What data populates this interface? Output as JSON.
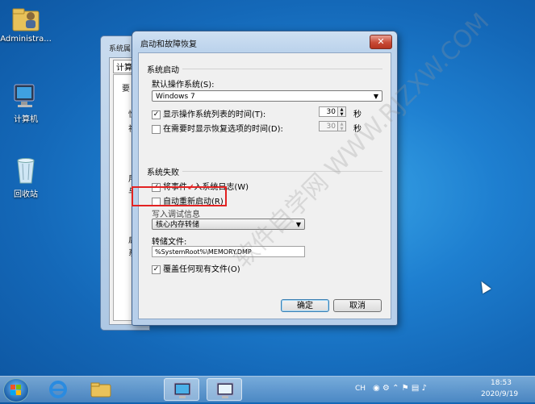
{
  "desktop": {
    "icons": [
      {
        "label": "Administra..."
      },
      {
        "label": "计算机"
      },
      {
        "label": "回收站"
      }
    ]
  },
  "back_window": {
    "title": "系统属",
    "tab": "计算",
    "fragments": [
      "要",
      "性",
      "视",
      "用",
      "与",
      "启",
      "系"
    ]
  },
  "dialog": {
    "title": "启动和故障恢复",
    "close_symbol": "✕",
    "startup": {
      "group_title": "系统启动",
      "default_os_label": "默认操作系统(S):",
      "default_os_value": "Windows 7",
      "show_list_label": "显示操作系统列表的时间(T):",
      "show_list_checked": true,
      "show_list_value": "30",
      "show_list_unit": "秒",
      "show_recovery_label": "在需要时显示恢复选项的时间(D):",
      "show_recovery_checked": false,
      "show_recovery_value": "30",
      "show_recovery_unit": "秒"
    },
    "failure": {
      "group_title": "系统失败",
      "write_event_label": "将事件",
      "write_event_label2": "入系统日志(W)",
      "write_event_checked": true,
      "auto_restart_label": "自动重新启动(R)",
      "auto_restart_checked": false,
      "debug_info_label": "写入调试信息",
      "debug_type_value": "核心内存转储",
      "dump_file_label": "转储文件:",
      "dump_file_value": "%SystemRoot%\\MEMORY.DMP",
      "overwrite_label": "覆盖任何现有文件(O)",
      "overwrite_checked": true
    },
    "ok_label": "确定",
    "cancel_label": "取消"
  },
  "watermark": "软件自学网 WWW.RJZXW.COM",
  "taskbar": {
    "lang": "CH",
    "time": "18:53",
    "date": "2020/9/19"
  }
}
